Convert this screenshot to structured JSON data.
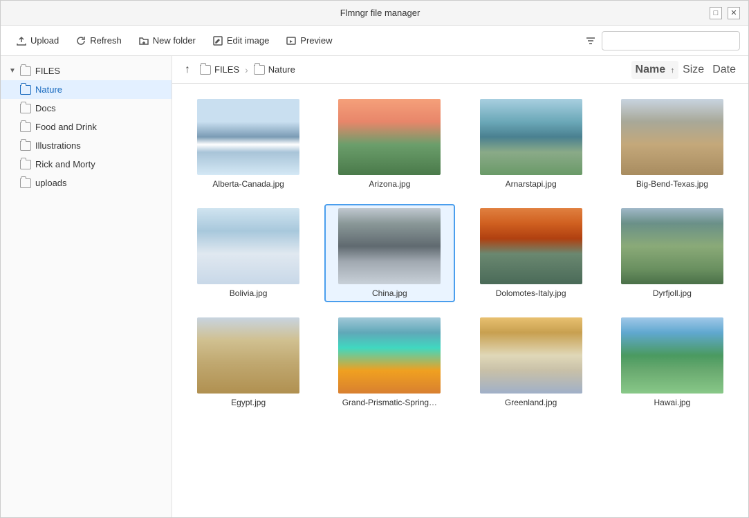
{
  "window": {
    "title": "Flmngr file manager",
    "maximize_label": "□",
    "close_label": "✕"
  },
  "toolbar": {
    "upload_label": "Upload",
    "refresh_label": "Refresh",
    "new_folder_label": "New folder",
    "edit_image_label": "Edit image",
    "preview_label": "Preview",
    "search_placeholder": ""
  },
  "sidebar": {
    "root_label": "FILES",
    "items": [
      {
        "id": "nature",
        "label": "Nature",
        "active": true
      },
      {
        "id": "docs",
        "label": "Docs",
        "active": false
      },
      {
        "id": "food-and-drink",
        "label": "Food and Drink",
        "active": false
      },
      {
        "id": "illustrations",
        "label": "Illustrations",
        "active": false
      },
      {
        "id": "rick-and-morty",
        "label": "Rick and Morty",
        "active": false
      },
      {
        "id": "uploads",
        "label": "uploads",
        "active": false
      }
    ]
  },
  "breadcrumb": {
    "up_label": "↑",
    "path_items": [
      {
        "label": "FILES"
      },
      {
        "label": "Nature"
      }
    ]
  },
  "sort": {
    "name_label": "Name",
    "size_label": "Size",
    "date_label": "Date",
    "active": "name",
    "direction": "↑"
  },
  "files": [
    {
      "id": "alberta",
      "name": "Alberta-Canada.jpg",
      "thumb_class": "thumb-alberta",
      "selected": false
    },
    {
      "id": "arizona",
      "name": "Arizona.jpg",
      "thumb_class": "thumb-arizona",
      "selected": false
    },
    {
      "id": "arnarstapi",
      "name": "Arnarstapi.jpg",
      "thumb_class": "thumb-arnarstapi",
      "selected": false
    },
    {
      "id": "bigbend",
      "name": "Big-Bend-Texas.jpg",
      "thumb_class": "thumb-bigbend",
      "selected": false
    },
    {
      "id": "bolivia",
      "name": "Bolivia.jpg",
      "thumb_class": "thumb-bolivia",
      "selected": false
    },
    {
      "id": "china",
      "name": "China.jpg",
      "thumb_class": "thumb-china",
      "selected": true
    },
    {
      "id": "dolomotes",
      "name": "Dolomotes-Italy.jpg",
      "thumb_class": "thumb-dolomotes",
      "selected": false
    },
    {
      "id": "dyrfjoll",
      "name": "Dyrfjoll.jpg",
      "thumb_class": "thumb-dyrfjoll",
      "selected": false
    },
    {
      "id": "egypt",
      "name": "Egypt.jpg",
      "thumb_class": "thumb-egypt",
      "selected": false
    },
    {
      "id": "grandprismatic",
      "name": "Grand-Prismatic-Spring…",
      "thumb_class": "thumb-grandprismatic",
      "selected": false
    },
    {
      "id": "greenland",
      "name": "Greenland.jpg",
      "thumb_class": "thumb-greenland",
      "selected": false
    },
    {
      "id": "hawai",
      "name": "Hawai.jpg",
      "thumb_class": "thumb-hawai",
      "selected": false
    }
  ]
}
